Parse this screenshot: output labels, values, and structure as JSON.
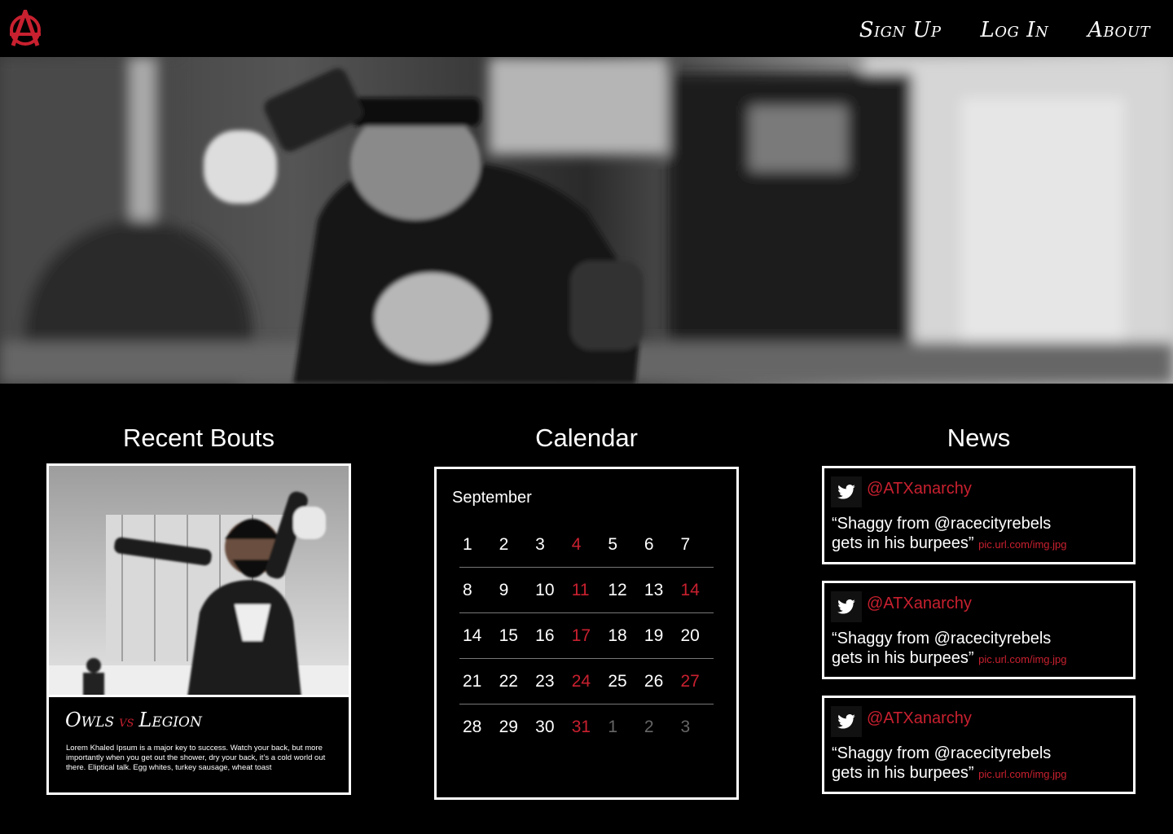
{
  "header": {
    "logo_alt": "Austin Anarchy",
    "nav": [
      {
        "label": "Sign Up"
      },
      {
        "label": "Log In"
      },
      {
        "label": "About"
      }
    ]
  },
  "sections": {
    "recent_bouts": {
      "title": "Recent Bouts",
      "bout": {
        "team_a": "Owls",
        "vs": "vs",
        "team_b": "Legion",
        "description": "Lorem Khaled Ipsum is a major key to success. Watch your back, but more importantly when you get out the shower, dry your back, it’s a cold world out there. Eliptical talk. Egg whites, turkey sausage, wheat toast"
      }
    },
    "calendar": {
      "title": "Calendar",
      "month": "September",
      "weeks": [
        [
          {
            "d": "1",
            "s": "normal"
          },
          {
            "d": "2",
            "s": "normal"
          },
          {
            "d": "3",
            "s": "normal"
          },
          {
            "d": "4",
            "s": "red"
          },
          {
            "d": "5",
            "s": "normal"
          },
          {
            "d": "6",
            "s": "normal"
          },
          {
            "d": "7",
            "s": "normal"
          }
        ],
        [
          {
            "d": "8",
            "s": "normal"
          },
          {
            "d": "9",
            "s": "normal"
          },
          {
            "d": "10",
            "s": "normal"
          },
          {
            "d": "11",
            "s": "red"
          },
          {
            "d": "12",
            "s": "normal"
          },
          {
            "d": "13",
            "s": "normal"
          },
          {
            "d": "14",
            "s": "red"
          }
        ],
        [
          {
            "d": "14",
            "s": "normal"
          },
          {
            "d": "15",
            "s": "normal"
          },
          {
            "d": "16",
            "s": "normal"
          },
          {
            "d": "17",
            "s": "red"
          },
          {
            "d": "18",
            "s": "normal"
          },
          {
            "d": "19",
            "s": "normal"
          },
          {
            "d": "20",
            "s": "normal"
          }
        ],
        [
          {
            "d": "21",
            "s": "normal"
          },
          {
            "d": "22",
            "s": "normal"
          },
          {
            "d": "23",
            "s": "normal"
          },
          {
            "d": "24",
            "s": "red"
          },
          {
            "d": "25",
            "s": "normal"
          },
          {
            "d": "26",
            "s": "normal"
          },
          {
            "d": "27",
            "s": "red"
          }
        ],
        [
          {
            "d": "28",
            "s": "normal"
          },
          {
            "d": "29",
            "s": "normal"
          },
          {
            "d": "30",
            "s": "normal"
          },
          {
            "d": "31",
            "s": "red"
          },
          {
            "d": "1",
            "s": "dim"
          },
          {
            "d": "2",
            "s": "dim"
          },
          {
            "d": "3",
            "s": "dim"
          }
        ]
      ]
    },
    "news": {
      "title": "News",
      "items": [
        {
          "handle": "@ATXanarchy",
          "text_line1": "“Shaggy from @racecityrebels",
          "text_line2": "gets in his burpees”",
          "link": "pic.url.com/img.jpg"
        },
        {
          "handle": "@ATXanarchy",
          "text_line1": "“Shaggy from @racecityrebels",
          "text_line2": "gets in his burpees”",
          "link": "pic.url.com/img.jpg"
        },
        {
          "handle": "@ATXanarchy",
          "text_line1": "“Shaggy from @racecityrebels",
          "text_line2": "gets in his burpees”",
          "link": "pic.url.com/img.jpg"
        }
      ]
    }
  },
  "theme": {
    "accent": "#c8202f",
    "background": "#000000",
    "text": "#ffffff"
  },
  "icons": {
    "logo": "anarchy-a-logo",
    "tweet": "twitter-bird-icon"
  }
}
